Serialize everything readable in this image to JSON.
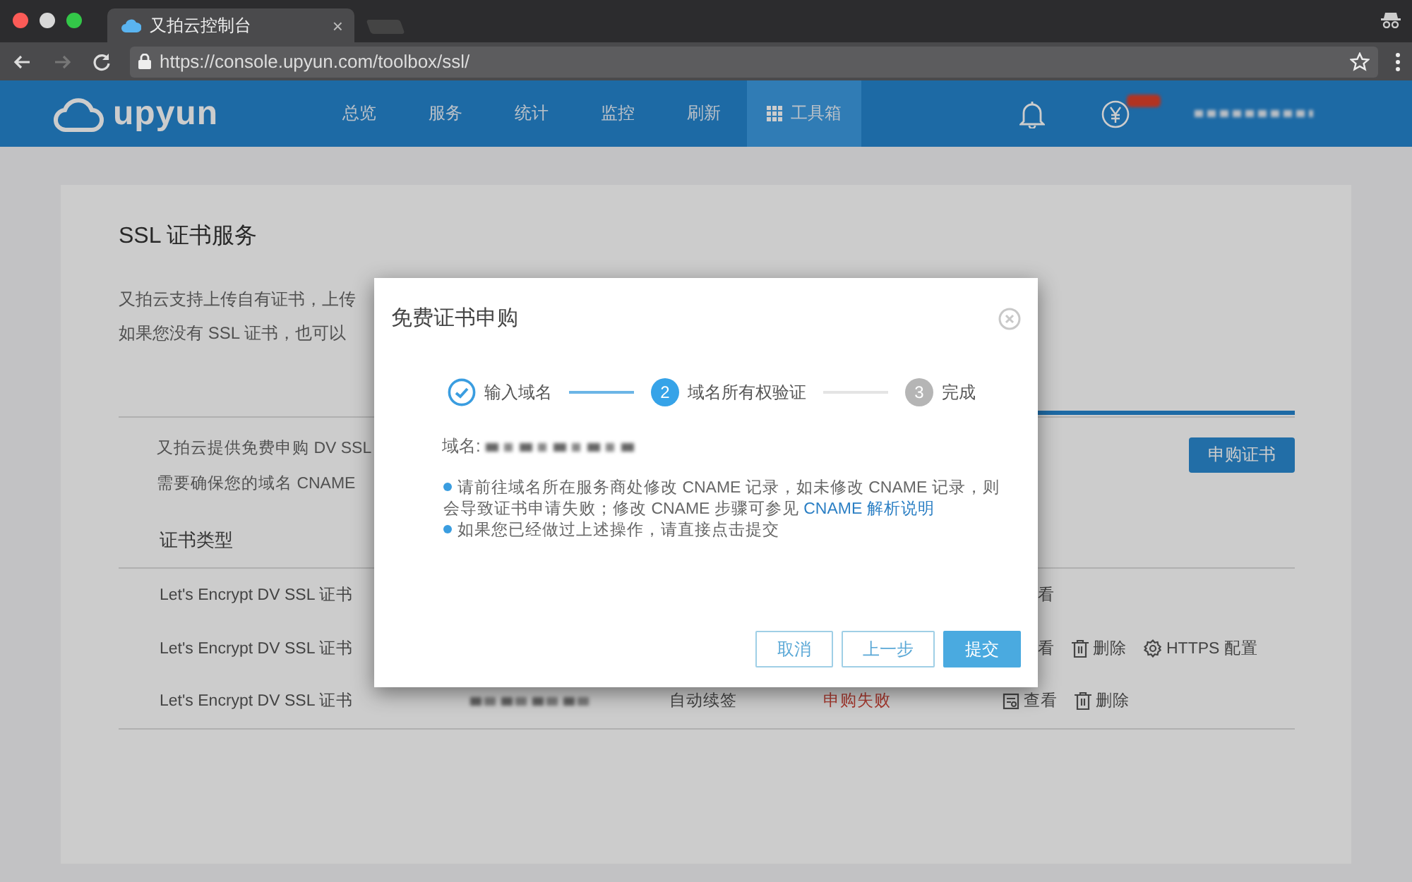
{
  "browser": {
    "tab": {
      "title": "又拍云控制台",
      "close": "×"
    },
    "nav": [
      {
        "kind": "back",
        "disabled": false
      },
      {
        "kind": "forward",
        "disabled": true
      },
      {
        "kind": "reload",
        "disabled": false
      }
    ],
    "url": "https://console.upyun.com/toolbox/ssl/"
  },
  "header": {
    "logo": "upyun",
    "nav_items": [
      {
        "label": "总览",
        "selected": false,
        "kind": "text"
      },
      {
        "label": "服务",
        "selected": false,
        "kind": "text"
      },
      {
        "label": "统计",
        "selected": false,
        "kind": "text"
      },
      {
        "label": "监控",
        "selected": false,
        "kind": "text"
      },
      {
        "label": "刷新",
        "selected": false,
        "kind": "text"
      },
      {
        "label": "工具箱",
        "selected": true,
        "kind": "grid"
      }
    ]
  },
  "page": {
    "title": "SSL 证书服务",
    "intro": [
      "又拍云支持上传自有证书，上传",
      "如果您没有 SSL 证书，也可以"
    ],
    "free_info": [
      "又拍云提供免费申购 DV SSL",
      "需要确保您的域名 CNAME"
    ],
    "buy_button": "申购证书",
    "table": {
      "columns": [
        "证书类型"
      ],
      "rows": [
        {
          "type": "Let's Encrypt DV SSL 证书",
          "actions": [
            {
              "kind": "view",
              "label": "看",
              "icon": false
            }
          ]
        },
        {
          "type": "Let's Encrypt DV SSL 证书",
          "actions": [
            {
              "kind": "view",
              "label": "看",
              "icon": false
            },
            {
              "kind": "delete",
              "label": "删除",
              "icon": true
            },
            {
              "kind": "https",
              "label": "HTTPS 配置",
              "icon": true
            }
          ]
        },
        {
          "type": "Let's Encrypt DV SSL 证书",
          "domain_blurred": true,
          "renew": "自动续签",
          "status": "申购失败",
          "actions": [
            {
              "kind": "view",
              "label": "查看",
              "icon": true
            },
            {
              "kind": "delete",
              "label": "删除",
              "icon": true
            }
          ]
        }
      ]
    }
  },
  "modal": {
    "title": "免费证书申购",
    "steps": [
      {
        "label": "输入域名",
        "done": true,
        "selected": false
      },
      {
        "label": "域名所有权验证",
        "number": "2",
        "done": false,
        "selected": true
      },
      {
        "label": "完成",
        "number": "3",
        "done": false,
        "selected": false
      }
    ],
    "domain_label": "域名:",
    "notes": [
      {
        "text": "请前往域名所在服务商处修改 CNAME 记录，如未修改 CNAME 记录，则会导致证书申请失败；修改 CNAME 步骤可参见",
        "link": "CNAME 解析说明"
      },
      {
        "text": "如果您已经做过上述操作，请直接点击提交"
      }
    ],
    "buttons": [
      {
        "label": "取消",
        "kind": "secondary"
      },
      {
        "label": "上一步",
        "kind": "secondary"
      },
      {
        "label": "提交",
        "kind": "primary"
      }
    ]
  }
}
